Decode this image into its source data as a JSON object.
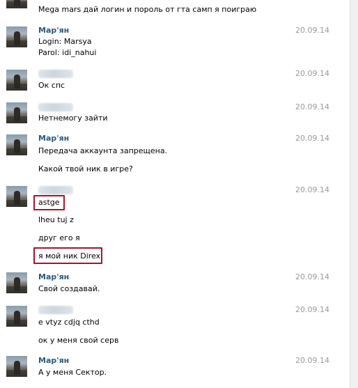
{
  "messages": [
    {
      "name": "",
      "date": "",
      "lines": [
        "Mega mars дай логин и пороль от гта самп я поиграю"
      ]
    },
    {
      "name": "Мар'ян",
      "date": "20.09.14",
      "lines": [
        "Login: Marsya",
        "Parol: idi_nahui"
      ]
    },
    {
      "name": "",
      "date": "20.09.14",
      "lines": [
        "Ок спс"
      ]
    },
    {
      "name": "",
      "date": "20.09.14",
      "lines": [
        "Нетнемогу зайти"
      ]
    },
    {
      "name": "Мар'ян",
      "date": "20.09.14",
      "lines": [
        "Передача аккаунта запрещена.",
        "Какой твой ник в игре?"
      ]
    },
    {
      "name": "",
      "date": "20.09.14",
      "lines": [
        "astge",
        "lheu tuj z",
        "друг его я",
        "я мой ник Direx"
      ]
    },
    {
      "name": "Мар'ян",
      "date": "20.09.14",
      "lines": [
        "Свой создавай."
      ]
    },
    {
      "name": "",
      "date": "20.09.14",
      "lines": [
        "e vtyz cdjq cthd",
        "ок у меня свой серв"
      ]
    },
    {
      "name": "Мар'ян",
      "date": "20.09.14",
      "lines": [
        "А у меня Сектор."
      ]
    }
  ]
}
